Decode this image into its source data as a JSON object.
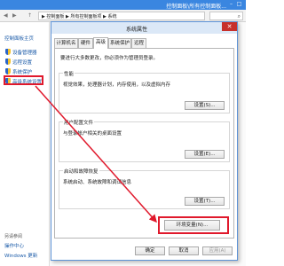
{
  "window": {
    "title": "控制面板\\所有控制面板..."
  },
  "address": {
    "back": "◀",
    "forward": "▶",
    "up": "↑",
    "breadcrumb": "▶ 控制面板 ▶ 所有控制面板项 ▶ 系统"
  },
  "sidebar": {
    "home_link": "控制面板主页",
    "items": [
      {
        "label": "设备管理器"
      },
      {
        "label": "远程设置"
      },
      {
        "label": "系统保护"
      },
      {
        "label": "高级系统设置"
      }
    ],
    "see_also": "另请参阅",
    "bottom_items": [
      {
        "label": "操作中心"
      },
      {
        "label": "Windows 更新"
      }
    ]
  },
  "dialog": {
    "title": "系统属性",
    "close": "✕",
    "tabs": [
      {
        "label": "计算机名"
      },
      {
        "label": "硬件"
      },
      {
        "label": "高级"
      },
      {
        "label": "系统保护"
      },
      {
        "label": "远程"
      }
    ],
    "active_tab": "高级",
    "note": "要进行大多数更改，你必须作为管理员登录。",
    "groups": [
      {
        "title": "性能",
        "desc": "视觉效果，处理器计划，内存使用，以及虚拟内存",
        "button": "设置(S)..."
      },
      {
        "title": "用户配置文件",
        "desc": "与登录帐户相关的桌面设置",
        "button": "设置(E)..."
      },
      {
        "title": "启动和故障恢复",
        "desc": "系统启动、系统故障和调试信息",
        "button": "设置(T)..."
      }
    ],
    "env_button": "环境变量(N)...",
    "ok": "确定",
    "cancel": "取消",
    "apply": "应用(A)"
  },
  "colors": {
    "highlight": "#e0192c",
    "link": "#1a5aa8",
    "titlebar": "#3a86e0"
  }
}
